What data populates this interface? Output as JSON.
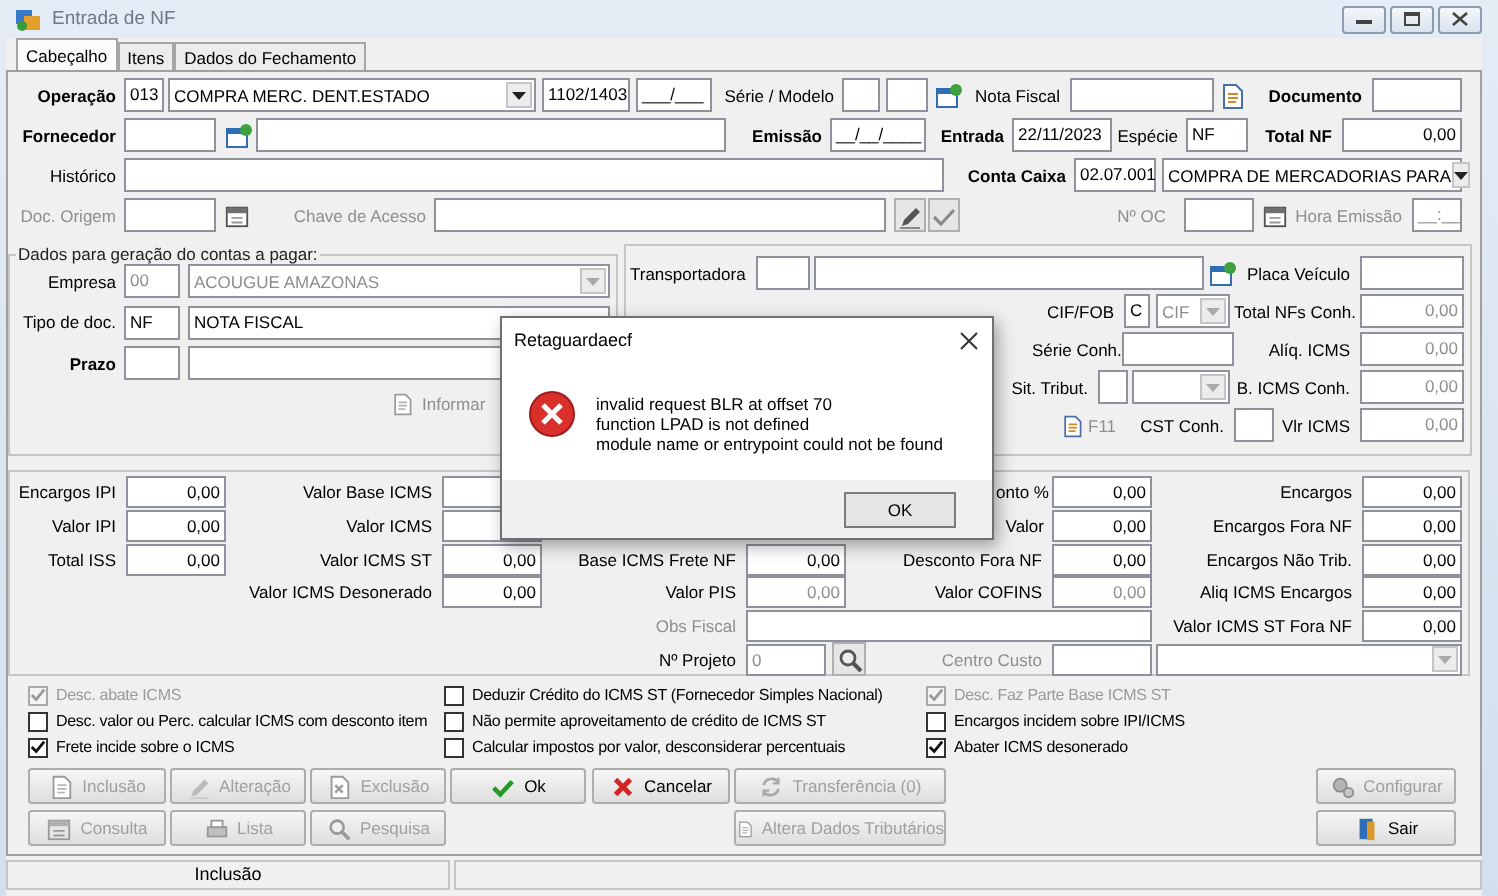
{
  "window": {
    "title": "Entrada de NF"
  },
  "tabs": [
    {
      "label": "Cabeçalho",
      "selected": true
    },
    {
      "label": "Itens",
      "selected": false
    },
    {
      "label": "Dados do Fechamento",
      "selected": false
    }
  ],
  "header": {
    "rows": [
      {
        "items": [
          {
            "kind": "strong",
            "text": "Operação"
          },
          {
            "kind": "field",
            "value": "013"
          },
          {
            "kind": "combo",
            "value": "COMPRA MERC. DENT.ESTADO"
          },
          {
            "kind": "field",
            "value": "1102/1403"
          },
          {
            "kind": "field",
            "value": "___/___"
          },
          {
            "kind": "label",
            "text": "Série / Modelo"
          },
          {
            "kind": "field"
          },
          {
            "kind": "field"
          },
          {
            "kind": "lookup"
          },
          {
            "kind": "label",
            "text": "Nota Fiscal"
          },
          {
            "kind": "field"
          },
          {
            "kind": "notepad"
          },
          {
            "kind": "strong",
            "text": "Documento"
          },
          {
            "kind": "field"
          }
        ]
      },
      {
        "items": [
          {
            "kind": "strong",
            "text": "Fornecedor"
          },
          {
            "kind": "field"
          },
          {
            "kind": "lookup"
          },
          {
            "kind": "field"
          },
          {
            "kind": "strong",
            "text": "Emissão"
          },
          {
            "kind": "field",
            "value": "__/__/____"
          },
          {
            "kind": "strong",
            "text": "Entrada"
          },
          {
            "kind": "field",
            "value": "22/11/2023"
          },
          {
            "kind": "label",
            "text": "Espécie"
          },
          {
            "kind": "field",
            "value": "NF"
          },
          {
            "kind": "strong",
            "text": "Total NF"
          },
          {
            "kind": "amount",
            "value": "0,00"
          }
        ]
      },
      {
        "items": [
          {
            "kind": "label",
            "text": "Histórico"
          },
          {
            "kind": "field"
          },
          {
            "kind": "strong",
            "text": "Conta Caixa"
          },
          {
            "kind": "field",
            "value": "02.07.001"
          },
          {
            "kind": "combo",
            "value": "COMPRA DE MERCADORIAS PARA"
          }
        ]
      },
      {
        "items": [
          {
            "kind": "dim",
            "text": "Doc. Origem"
          },
          {
            "kind": "field"
          },
          {
            "kind": "calendar"
          },
          {
            "kind": "dim",
            "text": "Chave de Acesso"
          },
          {
            "kind": "field"
          },
          {
            "kind": "edit"
          },
          {
            "kind": "check"
          },
          {
            "kind": "dim",
            "text": "Nº OC"
          },
          {
            "kind": "field"
          },
          {
            "kind": "calendar"
          },
          {
            "kind": "dim",
            "text": "Hora Emissão"
          },
          {
            "kind": "field-dim",
            "value": "__:__"
          }
        ]
      }
    ]
  },
  "payables": {
    "legend": "Dados para geração do contas a pagar:",
    "rows": [
      {
        "items": [
          {
            "kind": "label",
            "text": "Empresa"
          },
          {
            "kind": "field-dim",
            "value": "00"
          },
          {
            "kind": "combo-dim",
            "value": "ACOUGUE AMAZONAS"
          }
        ]
      },
      {
        "items": [
          {
            "kind": "label",
            "text": "Tipo de doc."
          },
          {
            "kind": "field",
            "value": "NF"
          },
          {
            "kind": "field",
            "value": "NOTA FISCAL"
          }
        ]
      },
      {
        "items": [
          {
            "kind": "strong",
            "text": "Prazo"
          },
          {
            "kind": "field"
          },
          {
            "kind": "field"
          }
        ]
      }
    ],
    "action": "Informar"
  },
  "transport": {
    "rows": [
      {
        "items": [
          {
            "kind": "label",
            "text": "Transportadora"
          },
          {
            "kind": "field"
          },
          {
            "kind": "field"
          },
          {
            "kind": "lookup"
          },
          {
            "kind": "label",
            "text": "Placa Veículo"
          },
          {
            "kind": "field"
          }
        ]
      },
      {
        "items": [
          {
            "kind": "label",
            "text": "CIF/FOB"
          },
          {
            "kind": "field",
            "value": "C"
          },
          {
            "kind": "combo-dim",
            "value": "CIF"
          },
          {
            "kind": "label",
            "text": "Total NFs Conh."
          },
          {
            "kind": "amount-dim",
            "value": "0,00"
          }
        ]
      },
      {
        "items": [
          {
            "kind": "label",
            "text": "Série Conh."
          },
          {
            "kind": "field"
          },
          {
            "kind": "label",
            "text": "Alíq. ICMS"
          },
          {
            "kind": "amount-dim",
            "value": "0,00"
          }
        ]
      },
      {
        "items": [
          {
            "kind": "label",
            "text": "Sit. Tribut."
          },
          {
            "kind": "field"
          },
          {
            "kind": "combo-dim"
          },
          {
            "kind": "label",
            "text": "B. ICMS Conh."
          },
          {
            "kind": "amount-dim",
            "value": "0,00"
          }
        ]
      },
      {
        "items": [
          {
            "kind": "notepad"
          },
          {
            "kind": "dim",
            "text": "F11"
          },
          {
            "kind": "label",
            "text": "CST Conh."
          },
          {
            "kind": "field"
          },
          {
            "kind": "label",
            "text": "Vlr ICMS"
          },
          {
            "kind": "amount-dim",
            "value": "0,00"
          }
        ]
      }
    ]
  },
  "totals": {
    "rows": [
      {
        "items": [
          {
            "kind": "label",
            "text": "Encargos IPI"
          },
          {
            "kind": "amount",
            "value": "0,00"
          },
          {
            "kind": "label",
            "text": "Valor Base ICMS"
          },
          {
            "kind": "field"
          },
          {
            "kind": "label",
            "text": "onto %"
          },
          {
            "kind": "amount",
            "value": "0,00"
          },
          {
            "kind": "label",
            "text": "Encargos"
          },
          {
            "kind": "amount",
            "value": "0,00"
          }
        ]
      },
      {
        "items": [
          {
            "kind": "label",
            "text": "Valor IPI"
          },
          {
            "kind": "amount",
            "value": "0,00"
          },
          {
            "kind": "label",
            "text": "Valor ICMS"
          },
          {
            "kind": "field"
          },
          {
            "kind": "label",
            "text": "Valor"
          },
          {
            "kind": "amount",
            "value": "0,00"
          },
          {
            "kind": "label",
            "text": "Encargos Fora NF"
          },
          {
            "kind": "amount",
            "value": "0,00"
          }
        ]
      },
      {
        "items": [
          {
            "kind": "label",
            "text": "Total ISS"
          },
          {
            "kind": "amount",
            "value": "0,00"
          },
          {
            "kind": "label",
            "text": "Valor ICMS ST"
          },
          {
            "kind": "amount",
            "value": "0,00"
          },
          {
            "kind": "label",
            "text": "Base ICMS Frete NF"
          },
          {
            "kind": "amount",
            "value": "0,00"
          },
          {
            "kind": "label",
            "text": "Desconto Fora NF"
          },
          {
            "kind": "amount",
            "value": "0,00"
          },
          {
            "kind": "label",
            "text": "Encargos Não Trib."
          },
          {
            "kind": "amount",
            "value": "0,00"
          }
        ]
      },
      {
        "items": [
          {
            "kind": "label",
            "text": "Valor ICMS Desonerado"
          },
          {
            "kind": "amount",
            "value": "0,00"
          },
          {
            "kind": "label",
            "text": "Valor PIS"
          },
          {
            "kind": "amount-dim",
            "value": "0,00"
          },
          {
            "kind": "label",
            "text": "Valor COFINS"
          },
          {
            "kind": "amount-dim",
            "value": "0,00"
          },
          {
            "kind": "label",
            "text": "Aliq ICMS Encargos"
          },
          {
            "kind": "amount",
            "value": "0,00"
          }
        ]
      },
      {
        "items": [
          {
            "kind": "dim",
            "text": "Obs Fiscal"
          },
          {
            "kind": "field"
          },
          {
            "kind": "label",
            "text": "Valor ICMS ST Fora NF"
          },
          {
            "kind": "amount",
            "value": "0,00"
          }
        ]
      },
      {
        "items": [
          {
            "kind": "label",
            "text": "Nº Projeto"
          },
          {
            "kind": "field-dim",
            "value": "0"
          },
          {
            "kind": "finder"
          },
          {
            "kind": "dim",
            "text": "Centro Custo"
          },
          {
            "kind": "field"
          },
          {
            "kind": "combo-dim"
          }
        ]
      }
    ]
  },
  "options": [
    [
      {
        "label": "Desc. abate ICMS",
        "checked": true,
        "disabled": true
      },
      {
        "label": "Desc. valor ou Perc. calcular ICMS com desconto item",
        "checked": false,
        "disabled": false
      },
      {
        "label": "Frete incide sobre o ICMS",
        "checked": true,
        "disabled": false
      }
    ],
    [
      {
        "label": "Deduzir Crédito do ICMS ST (Fornecedor Simples Nacional)",
        "checked": false,
        "disabled": false
      },
      {
        "label": "Não permite aproveitamento de crédito de ICMS ST",
        "checked": false,
        "disabled": false
      },
      {
        "label": "Calcular impostos por valor, desconsiderar percentuais",
        "checked": false,
        "disabled": false
      }
    ],
    [
      {
        "label": "Desc. Faz Parte Base ICMS ST",
        "checked": true,
        "disabled": true
      },
      {
        "label": "Encargos incidem sobre IPI/ICMS",
        "checked": false,
        "disabled": false
      },
      {
        "label": "Abater ICMS desonerado",
        "checked": true,
        "disabled": false
      }
    ]
  ],
  "buttons": [
    [
      {
        "kind": "add",
        "label": "Inclusão",
        "disabled": true
      },
      {
        "kind": "edit",
        "label": "Alteração",
        "disabled": true
      },
      {
        "kind": "delete",
        "label": "Exclusão",
        "disabled": true
      },
      {
        "kind": "ok",
        "label": "Ok",
        "disabled": false
      },
      {
        "kind": "cancel",
        "label": "Cancelar",
        "disabled": false
      },
      {
        "kind": "transfer",
        "label": "Transferência (0)",
        "disabled": true
      },
      {
        "kind": "configure",
        "label": "Configurar",
        "disabled": true
      }
    ],
    [
      {
        "kind": "query",
        "label": "Consulta",
        "disabled": true
      },
      {
        "kind": "list",
        "label": "Lista",
        "disabled": true
      },
      {
        "kind": "search",
        "label": "Pesquisa",
        "disabled": true
      },
      {
        "kind": "taxes",
        "label": "Altera Dados Tributários",
        "disabled": true
      },
      {
        "kind": "exit",
        "label": "Sair",
        "disabled": false
      }
    ]
  ],
  "status_bar": {
    "mode": "Inclusão"
  },
  "dialog": {
    "title": "Retaguardaecf",
    "message": "invalid request BLR at offset 70\nfunction LPAD is not defined\nmodule name or entrypoint could not be found",
    "button": "OK"
  }
}
